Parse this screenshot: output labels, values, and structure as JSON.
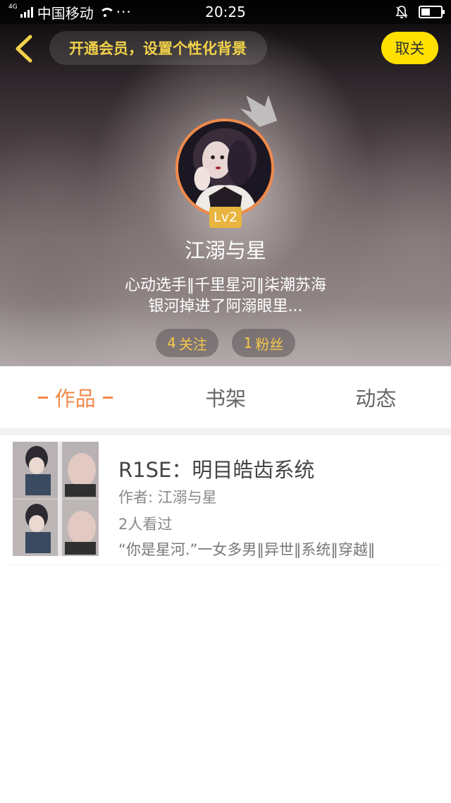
{
  "status_bar": {
    "network_type": "4G",
    "carrier": "中国移动",
    "more": "···",
    "time": "20:25",
    "battery_percent": 45
  },
  "header": {
    "back_icon": "chevron-left-icon",
    "vip_banner": "开通会员，设置个性化背景",
    "unfollow_label": "取关"
  },
  "profile": {
    "level": "Lv2",
    "username": "江溺与星",
    "bio_line1": "心动选手‖千里星河‖柒潮苏海",
    "bio_line2": "银河掉进了阿溺眼里...",
    "following_count": "4",
    "following_label": "关注",
    "fans_count": "1",
    "fans_label": "粉丝"
  },
  "tabs": [
    {
      "label": "作品",
      "active": true
    },
    {
      "label": "书架",
      "active": false
    },
    {
      "label": "动态",
      "active": false
    }
  ],
  "books": [
    {
      "title": "R1SE：明目皓齿系统",
      "author": "作者: 江溺与星",
      "views": "2人看过",
      "description": "“你是星河.”一女多男‖异世‖系统‖穿越‖"
    }
  ],
  "colors": {
    "accent": "#f08a4b",
    "unfollow_button": "#ffe000",
    "vip_text": "#f2d24a",
    "stat_text": "#f5c84b",
    "level_badge": "#e9b53e"
  }
}
